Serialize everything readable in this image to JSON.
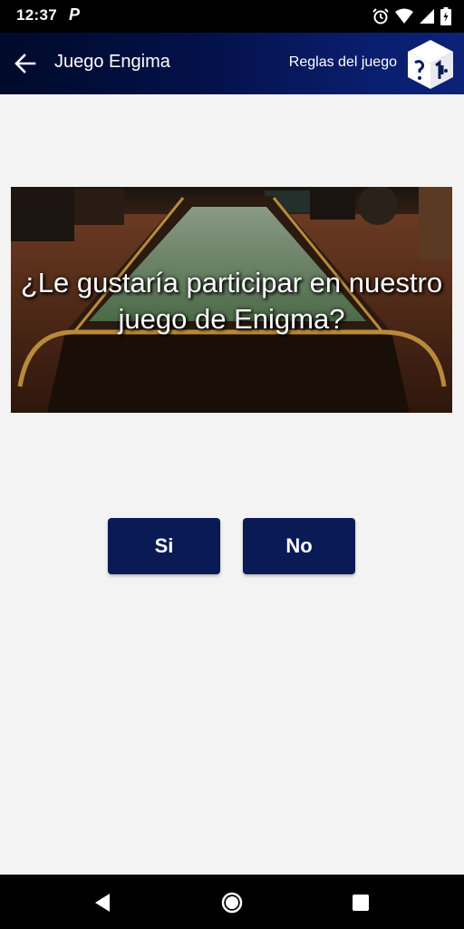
{
  "status_bar": {
    "time": "12:37",
    "notification_glyph": "P",
    "icons": [
      "alarm-icon",
      "wifi-icon",
      "signal-icon",
      "battery-icon"
    ]
  },
  "app_bar": {
    "title": "Juego Engima",
    "rules_label": "Reglas del juego",
    "logo_icon": "cube-logo-icon"
  },
  "hero": {
    "question": "¿Le gustaría participar en nuestro juego de Enigma?"
  },
  "buttons": {
    "yes_label": "Si",
    "no_label": "No"
  },
  "colors": {
    "accent": "#0a1a55",
    "background": "#f3f3f3",
    "status_bar": "#000000"
  },
  "nav_bar": {
    "icons": [
      "back-triangle-icon",
      "home-circle-icon",
      "recents-square-icon"
    ]
  }
}
